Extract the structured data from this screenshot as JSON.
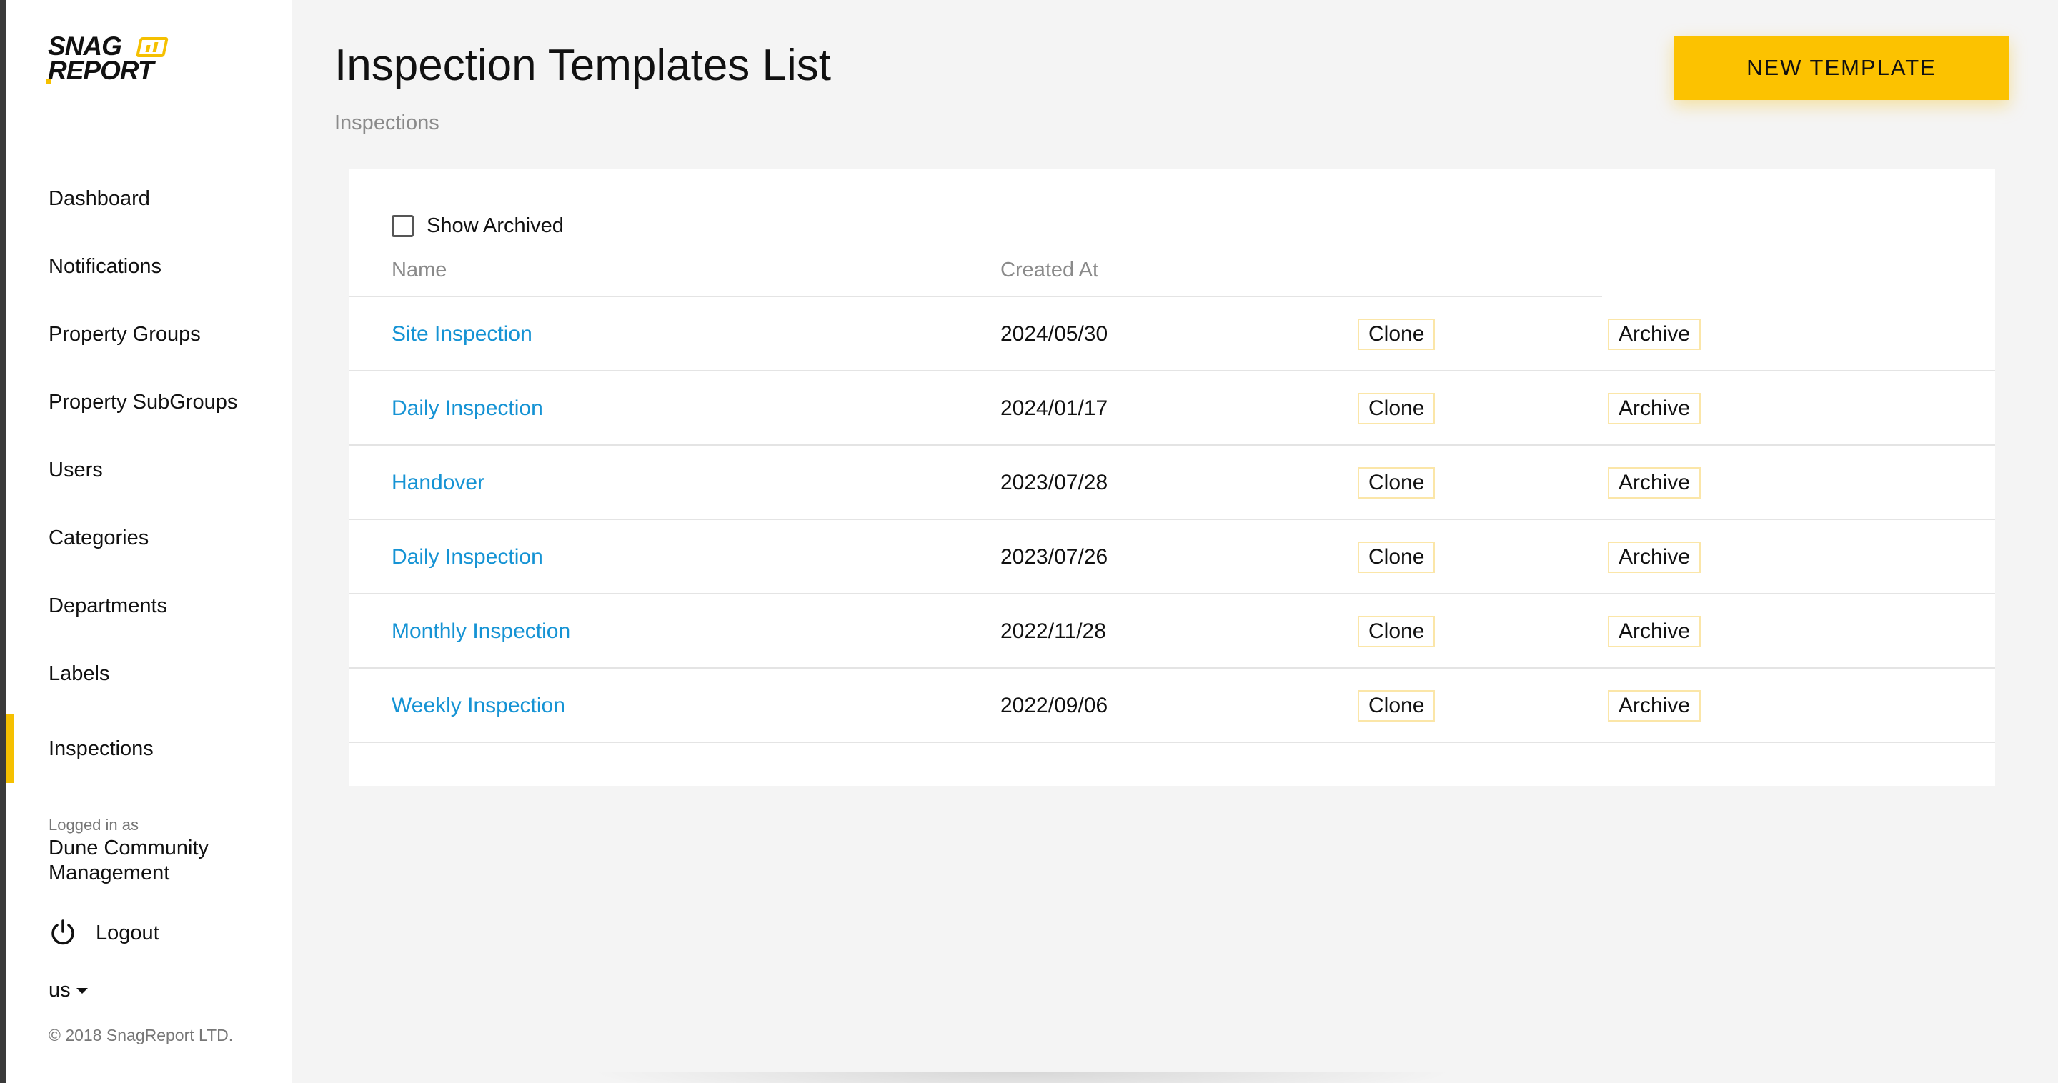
{
  "brand": {
    "logo_line1": "SNAG",
    "logo_line2": "REPORT",
    "accent_color": "#fcc200",
    "link_color": "#1593d4"
  },
  "sidebar": {
    "items": [
      {
        "label": "Dashboard",
        "active": false
      },
      {
        "label": "Notifications",
        "active": false
      },
      {
        "label": "Property Groups",
        "active": false
      },
      {
        "label": "Property SubGroups",
        "active": false
      },
      {
        "label": "Users",
        "active": false
      },
      {
        "label": "Categories",
        "active": false
      },
      {
        "label": "Departments",
        "active": false
      },
      {
        "label": "Labels",
        "active": false
      },
      {
        "label": "Inspections",
        "active": true
      }
    ],
    "logged_in_label": "Logged in as",
    "logged_in_name": "Dune Community Management",
    "logout_label": "Logout",
    "logout_icon": "power-icon",
    "language": "us",
    "copyright": "© 2018 SnagReport LTD."
  },
  "header": {
    "title": "Inspection Templates List",
    "breadcrumb": "Inspections",
    "new_button_label": "NEW TEMPLATE"
  },
  "table": {
    "show_archived_label": "Show Archived",
    "show_archived_checked": false,
    "columns": [
      "Name",
      "Created At"
    ],
    "rows": [
      {
        "name": "Site Inspection",
        "created_at": "2024/05/30",
        "clone": "Clone",
        "archive": "Archive"
      },
      {
        "name": "Daily Inspection",
        "created_at": "2024/01/17",
        "clone": "Clone",
        "archive": "Archive"
      },
      {
        "name": "Handover",
        "created_at": "2023/07/28",
        "clone": "Clone",
        "archive": "Archive"
      },
      {
        "name": "Daily Inspection",
        "created_at": "2023/07/26",
        "clone": "Clone",
        "archive": "Archive"
      },
      {
        "name": "Monthly Inspection",
        "created_at": "2022/11/28",
        "clone": "Clone",
        "archive": "Archive"
      },
      {
        "name": "Weekly Inspection",
        "created_at": "2022/09/06",
        "clone": "Clone",
        "archive": "Archive"
      }
    ]
  }
}
